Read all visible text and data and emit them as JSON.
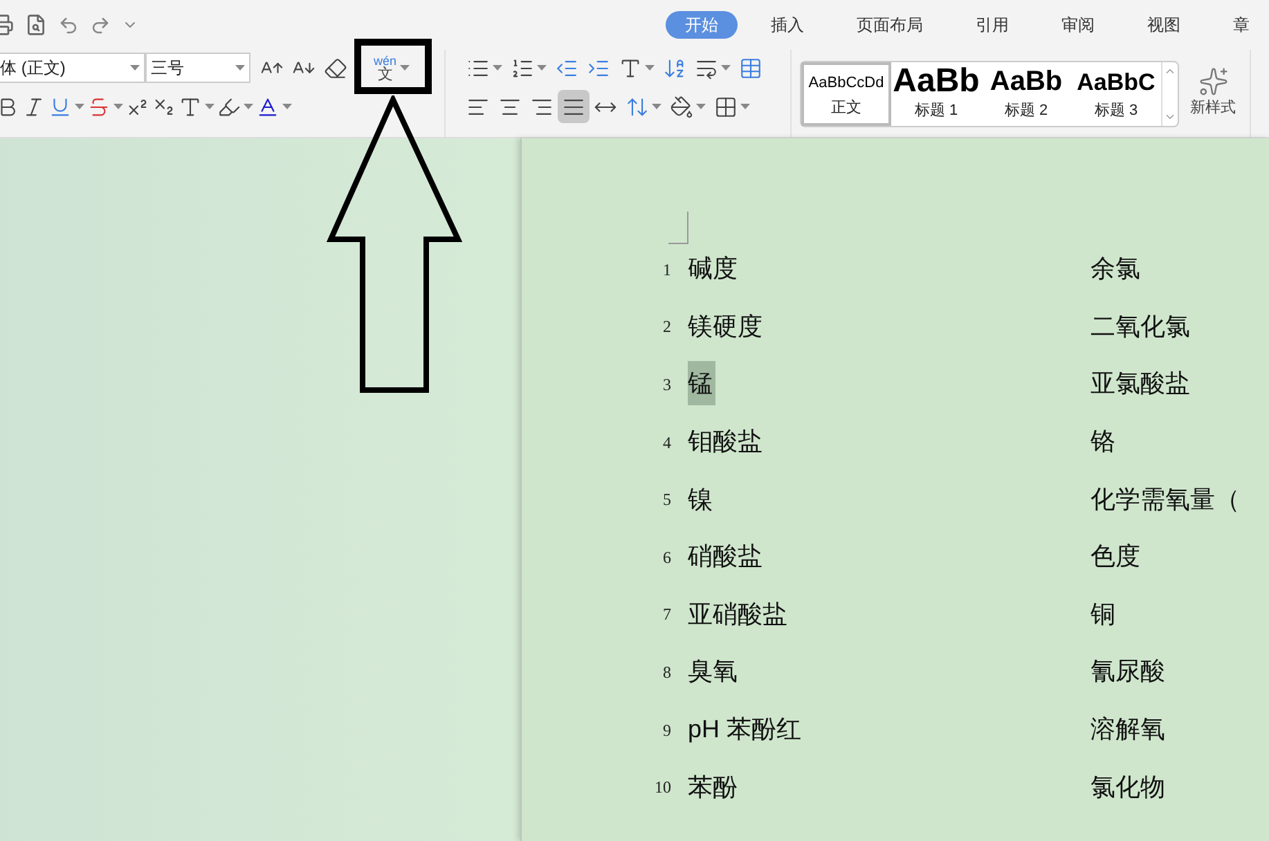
{
  "tabs": [
    {
      "label": "开始",
      "selected": true
    },
    {
      "label": "插入",
      "selected": false
    },
    {
      "label": "页面布局",
      "selected": false
    },
    {
      "label": "引用",
      "selected": false
    },
    {
      "label": "审阅",
      "selected": false
    },
    {
      "label": "视图",
      "selected": false
    },
    {
      "label": "章",
      "selected": false
    }
  ],
  "font": {
    "family": "体 (正文)",
    "size": "三号"
  },
  "phonetic_guide_button": {
    "pinyin": "wén",
    "character": "文"
  },
  "alignment": [
    {
      "kind": "left",
      "selected": false
    },
    {
      "kind": "center",
      "selected": false
    },
    {
      "kind": "right",
      "selected": false
    },
    {
      "kind": "justify",
      "selected": true
    },
    {
      "kind": "distributed",
      "selected": false
    }
  ],
  "styles": [
    {
      "preview": "AaBbCcDd",
      "label": "正文",
      "kind": "body",
      "selected": true
    },
    {
      "preview": "AaBb",
      "label": "标题 1",
      "kind": "h1",
      "selected": false
    },
    {
      "preview": "AaBb",
      "label": "标题 2",
      "kind": "h2",
      "selected": false
    },
    {
      "preview": "AaBbC",
      "label": "标题 3",
      "kind": "h3",
      "selected": false
    }
  ],
  "new_style": {
    "label": "新样式"
  },
  "document": {
    "rows": [
      {
        "number": "1",
        "left": "碱度",
        "right": "余氯",
        "highlighted": false
      },
      {
        "number": "2",
        "left": "镁硬度",
        "right": "二氧化氯",
        "highlighted": false
      },
      {
        "number": "3",
        "left": "锰",
        "right": "亚氯酸盐",
        "highlighted": true
      },
      {
        "number": "4",
        "left": "钼酸盐",
        "right": "铬",
        "highlighted": false
      },
      {
        "number": "5",
        "left": "镍",
        "right": "化学需氧量（",
        "highlighted": false
      },
      {
        "number": "6",
        "left": "硝酸盐",
        "right": "色度",
        "highlighted": false
      },
      {
        "number": "7",
        "left": "亚硝酸盐",
        "right": "铜",
        "highlighted": false
      },
      {
        "number": "8",
        "left": "臭氧",
        "right": "氰尿酸",
        "highlighted": false
      },
      {
        "number": "9",
        "left": "pH 苯酚红",
        "right": "溶解氧",
        "highlighted": false
      },
      {
        "number": "10",
        "left": "苯酚",
        "right": "氯化物",
        "highlighted": false
      }
    ]
  }
}
